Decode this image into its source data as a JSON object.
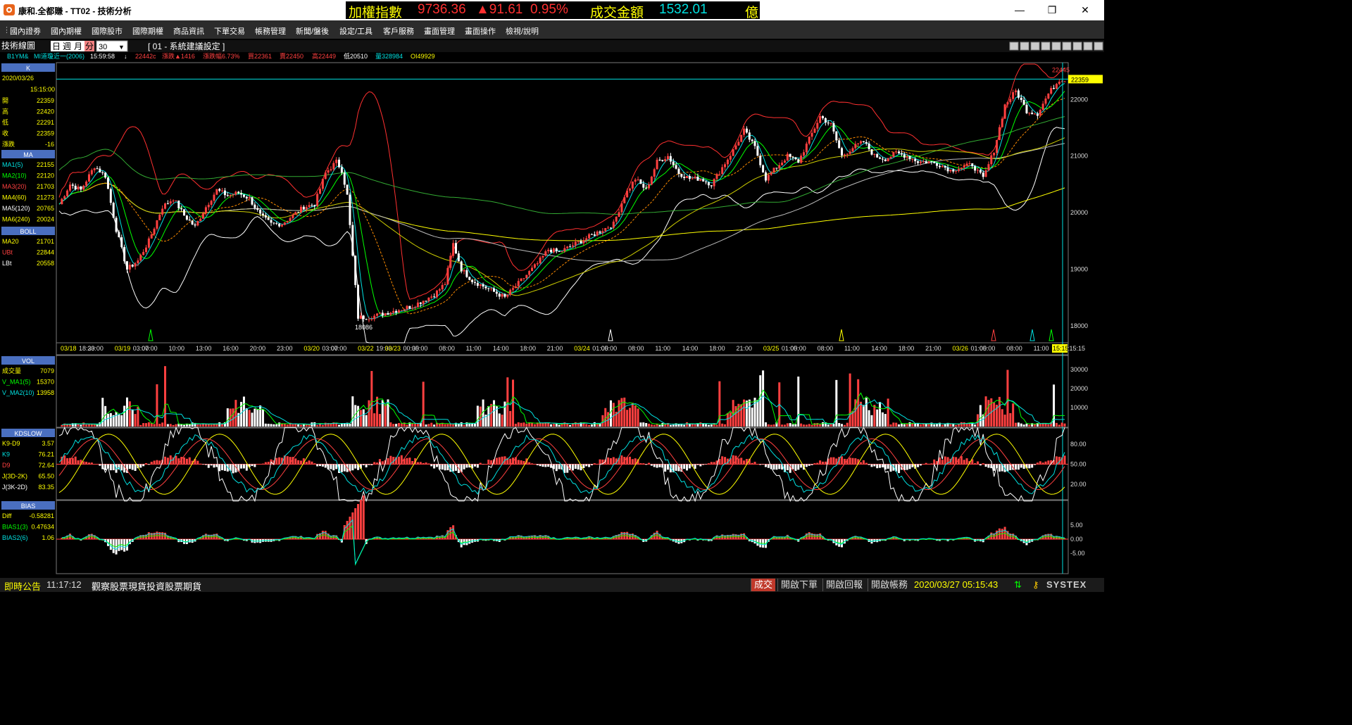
{
  "window": {
    "title": "康和.全都賺 - TT02 - 技術分析",
    "controls": {
      "minimize": "—",
      "maximize": "❐",
      "close": "✕"
    }
  },
  "ticker": {
    "index_label": "加權指數",
    "index_value": "9736.36",
    "index_change": "▲91.61",
    "index_pct": "0.95%",
    "amount_label": "成交金額",
    "amount_value": "1532.01",
    "amount_unit": "億"
  },
  "menu": [
    "國內證劵",
    "國內期權",
    "國際股市",
    "國際期權",
    "商品資訊",
    "下單交易",
    "帳務管理",
    "新聞/盤後",
    "設定/工具",
    "客戶服務",
    "畫面管理",
    "畫面操作",
    "檢視/說明"
  ],
  "toolbar": {
    "panel_label": "技術線圖",
    "period_tabs": [
      "日",
      "週",
      "月",
      "分"
    ],
    "selected_tab": "分",
    "interval_value": "30",
    "setting_label": "[ 01 - 系統建議設定 ]"
  },
  "quote": {
    "symbol": "B1YM&",
    "name": "MI道瓊近一(2006)",
    "time": "15:59:58",
    "arrow": "↓",
    "last": "22442c",
    "change": "漲跌▲1416",
    "change_pct": "漲跌幅6.73%",
    "bid": "買22361",
    "ask": "賣22450",
    "high": "高22449",
    "low": "低20510",
    "volume": "量328984",
    "oi": "OI49929"
  },
  "side_k": {
    "header": "K",
    "date": "2020/03/26",
    "time": "15:15:00",
    "rows": [
      {
        "label": "開",
        "value": "22359"
      },
      {
        "label": "高",
        "value": "22420"
      },
      {
        "label": "低",
        "value": "22291"
      },
      {
        "label": "收",
        "value": "22359"
      },
      {
        "label": "漲跌",
        "value": "-16"
      }
    ]
  },
  "side_ma": {
    "header": "MA",
    "rows": [
      {
        "label": "MA1(5)",
        "value": "22155",
        "color": "#00e0e0"
      },
      {
        "label": "MA2(10)",
        "value": "22120",
        "color": "#00ff00"
      },
      {
        "label": "MA3(20)",
        "value": "21703",
        "color": "#ff4040"
      },
      {
        "label": "MA4(60)",
        "value": "21273",
        "color": "#ffff00"
      },
      {
        "label": "MA5(120)",
        "value": "20765",
        "color": "#ffffff"
      },
      {
        "label": "MA6(240)",
        "value": "20024",
        "color": "#ffff00"
      }
    ]
  },
  "side_boll": {
    "header": "BOLL",
    "rows": [
      {
        "label": "MA20",
        "value": "21701",
        "color": "#ffff00"
      },
      {
        "label": "UBt",
        "value": "22844",
        "color": "#ff4040"
      },
      {
        "label": "LBt",
        "value": "20558",
        "color": "#ffffff"
      }
    ]
  },
  "side_vol": {
    "header": "VOL",
    "rows": [
      {
        "label": "成交量",
        "value": "7079",
        "color": "#ffff00"
      },
      {
        "label": "V_MA1(5)",
        "value": "15370",
        "color": "#00ff00"
      },
      {
        "label": "V_MA2(10)",
        "value": "13958",
        "color": "#00e0e0"
      }
    ]
  },
  "side_kd": {
    "header": "KDSLOW",
    "rows": [
      {
        "label": "K9-D9",
        "value": "3.57",
        "color": "#ffff00"
      },
      {
        "label": "K9",
        "value": "76.21",
        "color": "#00e0e0"
      },
      {
        "label": "D9",
        "value": "72.64",
        "color": "#ff4040"
      },
      {
        "label": "J(3D-2K)",
        "value": "65.50",
        "color": "#ffff00"
      },
      {
        "label": "J(3K-2D)",
        "value": "83.35",
        "color": "#ffffff"
      }
    ]
  },
  "side_bias": {
    "header": "BIAS",
    "rows": [
      {
        "label": "Diff",
        "value": "-0.58281",
        "color": "#ffff00"
      },
      {
        "label": "BIAS1(3)",
        "value": "0.47634",
        "color": "#00ff00"
      },
      {
        "label": "BIAS2(6)",
        "value": "1.06",
        "color": "#00e0e0"
      }
    ]
  },
  "chart_data": {
    "type": "candlestick",
    "price_axis": {
      "ticks": [
        "22000",
        "21000",
        "20000",
        "19000",
        "18000"
      ],
      "range": [
        17700,
        22650
      ]
    },
    "current_price_label": "22359",
    "high_label": "22445",
    "low_label": "18086",
    "time_ticks": [
      "03/18 18:30",
      "23:00",
      "03/19 03:00",
      "07:00",
      "10:00",
      "13:00",
      "16:00",
      "20:00",
      "23:00",
      "03/20 03:00",
      "07:00",
      "03/22 19:30",
      "03/23 00:30",
      "05:00",
      "08:00",
      "11:00",
      "14:00",
      "18:00",
      "21:00",
      "03/24 01:00",
      "05:00",
      "08:00",
      "11:00",
      "14:00",
      "18:00",
      "21:00",
      "03/25 01:00",
      "05:00",
      "08:00",
      "11:00",
      "14:00",
      "18:00",
      "21:00",
      "03/26 01:00",
      "05:00",
      "08:00",
      "11:00",
      "14:15:15"
    ],
    "cursor_time": "15:15",
    "vol_axis": [
      "30000",
      "20000",
      "10000"
    ],
    "kd_axis": [
      "80.00",
      "50.00",
      "20.00"
    ],
    "bias_axis": [
      "5.00",
      "0.00",
      "-5.00"
    ],
    "price_path": [
      [
        0,
        20150
      ],
      [
        4,
        20500
      ],
      [
        8,
        20400
      ],
      [
        13,
        20820
      ],
      [
        17,
        20650
      ],
      [
        21,
        19700
      ],
      [
        25,
        19000
      ],
      [
        29,
        19150
      ],
      [
        33,
        19500
      ],
      [
        38,
        20100
      ],
      [
        42,
        20250
      ],
      [
        46,
        19950
      ],
      [
        50,
        19750
      ],
      [
        54,
        20100
      ],
      [
        58,
        20400
      ],
      [
        62,
        20300
      ],
      [
        66,
        20350
      ],
      [
        70,
        20250
      ],
      [
        74,
        19950
      ],
      [
        78,
        19800
      ],
      [
        82,
        19800
      ],
      [
        86,
        19950
      ],
      [
        90,
        20100
      ],
      [
        94,
        20150
      ],
      [
        98,
        20700
      ],
      [
        102,
        20900
      ],
      [
        104,
        20750
      ],
      [
        106,
        20300
      ],
      [
        110,
        18150
      ],
      [
        114,
        18150
      ],
      [
        118,
        18200
      ],
      [
        122,
        18250
      ],
      [
        126,
        18300
      ],
      [
        130,
        18350
      ],
      [
        134,
        18450
      ],
      [
        138,
        18550
      ],
      [
        142,
        18750
      ],
      [
        145,
        19450
      ],
      [
        148,
        19000
      ],
      [
        152,
        18800
      ],
      [
        156,
        18700
      ],
      [
        160,
        18600
      ],
      [
        164,
        18500
      ],
      [
        168,
        18700
      ],
      [
        172,
        18900
      ],
      [
        176,
        19100
      ],
      [
        180,
        19350
      ],
      [
        184,
        19300
      ],
      [
        188,
        19400
      ],
      [
        192,
        19500
      ],
      [
        196,
        19600
      ],
      [
        200,
        19700
      ],
      [
        204,
        19800
      ],
      [
        208,
        20300
      ],
      [
        212,
        20600
      ],
      [
        216,
        20400
      ],
      [
        220,
        20900
      ],
      [
        224,
        21000
      ],
      [
        228,
        20700
      ],
      [
        232,
        20600
      ],
      [
        236,
        20600
      ],
      [
        240,
        20500
      ],
      [
        244,
        20800
      ],
      [
        248,
        21100
      ],
      [
        252,
        21450
      ],
      [
        256,
        21150
      ],
      [
        260,
        20600
      ],
      [
        264,
        20800
      ],
      [
        268,
        21000
      ],
      [
        272,
        20900
      ],
      [
        276,
        21300
      ],
      [
        280,
        21700
      ],
      [
        284,
        21550
      ],
      [
        288,
        21000
      ],
      [
        292,
        21150
      ],
      [
        296,
        21250
      ],
      [
        300,
        21000
      ],
      [
        304,
        20950
      ],
      [
        308,
        21050
      ],
      [
        312,
        21000
      ],
      [
        316,
        20900
      ],
      [
        320,
        20900
      ],
      [
        324,
        20850
      ],
      [
        328,
        20750
      ],
      [
        332,
        20800
      ],
      [
        336,
        20850
      ],
      [
        340,
        20600
      ],
      [
        344,
        21100
      ],
      [
        348,
        21900
      ],
      [
        352,
        22150
      ],
      [
        356,
        21800
      ],
      [
        360,
        21750
      ],
      [
        364,
        22100
      ],
      [
        368,
        22350
      ]
    ]
  }
}
